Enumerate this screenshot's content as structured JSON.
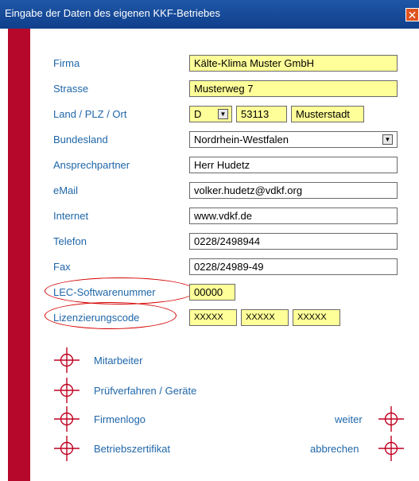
{
  "window": {
    "title": "Eingabe der Daten des eigenen KKF-Betriebes",
    "close_glyph": "✕"
  },
  "fields": {
    "firma": {
      "label": "Firma",
      "value": "Kälte-Klima Muster GmbH"
    },
    "strasse": {
      "label": "Strasse",
      "value": "Musterweg 7"
    },
    "land_plz_ort": {
      "label": "Land / PLZ / Ort",
      "land": "D",
      "plz": "53113",
      "ort": "Musterstadt"
    },
    "bundesland": {
      "label": "Bundesland",
      "value": "Nordrhein-Westfalen"
    },
    "ansprechpartner": {
      "label": "Ansprechpartner",
      "value": "Herr Hudetz"
    },
    "email": {
      "label": "eMail",
      "value": "volker.hudetz@vdkf.org"
    },
    "internet": {
      "label": "Internet",
      "value": "www.vdkf.de"
    },
    "telefon": {
      "label": "Telefon",
      "value": "0228/2498944"
    },
    "fax": {
      "label": "Fax",
      "value": "0228/24989-49"
    },
    "lec": {
      "label": "LEC-Softwarenummer",
      "value": "00000"
    },
    "lizenz": {
      "label": "Lizenzierungscode",
      "part1": "XXXXX",
      "part2": "XXXXX",
      "part3": "XXXXX"
    }
  },
  "nav": {
    "mitarbeiter": "Mitarbeiter",
    "pruefverfahren": "Prüfverfahren / Geräte",
    "firmenlogo": "Firmenlogo",
    "betriebszertifikat": "Betriebszertifikat",
    "weiter": "weiter",
    "abbrechen": "abbrechen"
  },
  "colors": {
    "accent_red": "#b5082b",
    "label_blue": "#1f66a8",
    "field_yellow": "#ffff99",
    "title_blue": "#1a4fa0"
  },
  "icons": {
    "dropdown": "triangle-down-icon",
    "nav": "crosshair-icon"
  }
}
